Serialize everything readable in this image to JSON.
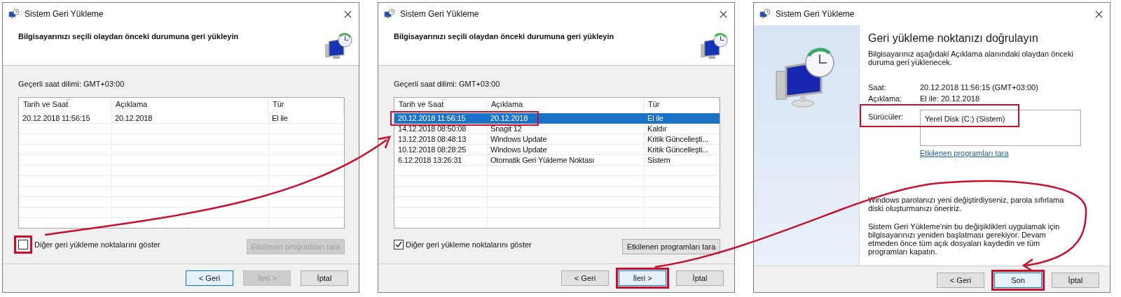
{
  "windows": [
    {
      "kind": "list",
      "title": "Sistem Geri Yükleme",
      "heading": "Bilgisayarınızı seçili olaydan önceki durumuna geri yükleyin",
      "timezone": "Geçerli saat dilimi: GMT+03:00",
      "columns": [
        "Tarih ve Saat",
        "Açıklama",
        "Tür"
      ],
      "rows": [
        {
          "cells": [
            "20.12.2018 11:56:15",
            "20.12.2018",
            "El ile"
          ],
          "selected": false,
          "highlighted": false
        }
      ],
      "show_more": {
        "label": "Diğer geri yükleme noktalarını göster",
        "checked": false,
        "highlighted": true
      },
      "scan_button": {
        "label": "Etkilenen programları tara",
        "disabled": true
      },
      "buttons": [
        {
          "label": "< Geri",
          "disabled": false,
          "default": true,
          "highlighted": false
        },
        {
          "label": "İleri >",
          "disabled": true,
          "default": false,
          "highlighted": false
        },
        {
          "label": "İptal",
          "disabled": false,
          "default": false,
          "highlighted": false
        }
      ]
    },
    {
      "kind": "list",
      "title": "Sistem Geri Yükleme",
      "heading": "Bilgisayarınızı seçili olaydan önceki durumuna geri yükleyin",
      "timezone": "Geçerli saat dilimi: GMT+03:00",
      "columns": [
        "Tarih ve Saat",
        "Açıklama",
        "Tür"
      ],
      "rows": [
        {
          "cells": [
            "20.12.2018 11:56:15",
            "20.12.2018",
            "El ile"
          ],
          "selected": true,
          "highlighted": true
        },
        {
          "cells": [
            "14.12.2018 08:50:08",
            "Snagit 12",
            "Kaldır"
          ],
          "selected": false,
          "highlighted": false
        },
        {
          "cells": [
            "13.12.2018 08:48:13",
            "Windows Update",
            "Kritik Güncelleşti..."
          ],
          "selected": false,
          "highlighted": false
        },
        {
          "cells": [
            "10.12.2018 08:28:25",
            "Windows Update",
            "Kritik Güncelleşti..."
          ],
          "selected": false,
          "highlighted": false
        },
        {
          "cells": [
            "6.12.2018 13:26:31",
            "Otomatik Geri Yükleme Noktası",
            "Sistem"
          ],
          "selected": false,
          "highlighted": false
        }
      ],
      "show_more": {
        "label": "Diğer geri yükleme noktalarını göster",
        "checked": true,
        "highlighted": false
      },
      "scan_button": {
        "label": "Etkilenen programları tara",
        "disabled": false
      },
      "buttons": [
        {
          "label": "< Geri",
          "disabled": false,
          "default": false,
          "highlighted": false
        },
        {
          "label": "İleri >",
          "disabled": false,
          "default": true,
          "highlighted": true
        },
        {
          "label": "İptal",
          "disabled": false,
          "default": false,
          "highlighted": false
        }
      ]
    },
    {
      "kind": "confirm",
      "title": "Sistem Geri Yükleme",
      "heading": "Geri yükleme noktanızı doğrulayın",
      "intro": "Bilgisayarınız aşağıdaki Açıklama alanındaki olaydan önceki duruma geri yüklenecek.",
      "fields": [
        {
          "label": "Saat:",
          "value": "20.12.2018 11:56:15 (GMT+03:00)"
        },
        {
          "label": "Açıklama:",
          "value": "El ile: 20.12.2018"
        }
      ],
      "drives": {
        "label": "Sürücüler:",
        "items": [
          "Yerel Disk (C:) (Sistem)"
        ],
        "highlighted": true
      },
      "link": "Etkilenen programları tara",
      "notes": [
        "Windows parolanızı yeni değiştirdiyseniz, parola sıfırlama diski oluşturmanızı öneririz.",
        "Sistem Geri Yükleme'nin bu değişiklikleri uygulamak için bilgisayarınızı yeniden başlatması gerekiyor. Devam etmeden önce tüm açık dosyaları kaydedin ve tüm programları kapatın."
      ],
      "buttons": [
        {
          "label": "< Geri",
          "disabled": false,
          "default": false,
          "highlighted": false
        },
        {
          "label": "Son",
          "disabled": false,
          "default": true,
          "highlighted": true
        },
        {
          "label": "İptal",
          "disabled": false,
          "default": false,
          "highlighted": false
        }
      ]
    }
  ]
}
